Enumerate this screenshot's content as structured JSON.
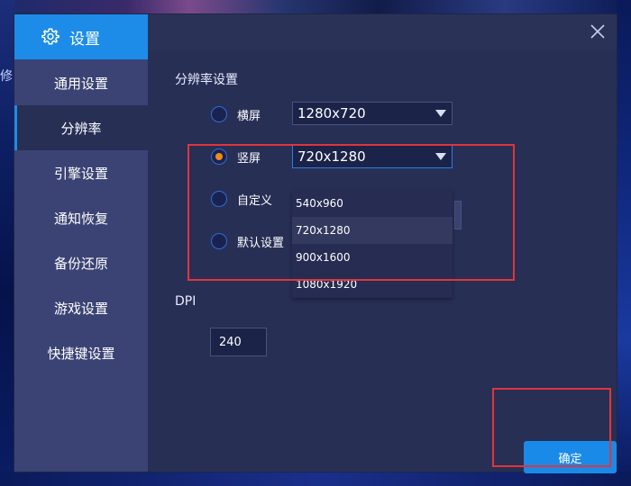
{
  "dialog": {
    "title": "设置",
    "icon": "gear-icon",
    "close_icon": "close-icon"
  },
  "sidebar": {
    "items": [
      {
        "label": "通用设置",
        "active": false
      },
      {
        "label": "分辨率",
        "active": true
      },
      {
        "label": "引擎设置",
        "active": false
      },
      {
        "label": "通知恢复",
        "active": false
      },
      {
        "label": "备份还原",
        "active": false
      },
      {
        "label": "游戏设置",
        "active": false
      },
      {
        "label": "快捷键设置",
        "active": false
      }
    ]
  },
  "background": {
    "left_glyph": "修"
  },
  "resolution": {
    "section_title": "分辨率设置",
    "landscape": {
      "label": "横屏",
      "value": "1280x720",
      "checked": false
    },
    "portrait": {
      "label": "竖屏",
      "value": "720x1280",
      "checked": true
    },
    "custom": {
      "label": "自定义",
      "checked": false
    },
    "default": {
      "label": "默认设置",
      "checked": false
    },
    "dropdown_options": [
      "540x960",
      "720x1280",
      "900x1600",
      "1080x1920"
    ],
    "hovered_option": "720x1280"
  },
  "dpi": {
    "label": "DPI",
    "value": "240"
  },
  "buttons": {
    "confirm": "确定"
  },
  "colors": {
    "accent": "#1c8ce8",
    "radio_checked": "#f08a1a",
    "highlight_box": "#e0353b"
  }
}
